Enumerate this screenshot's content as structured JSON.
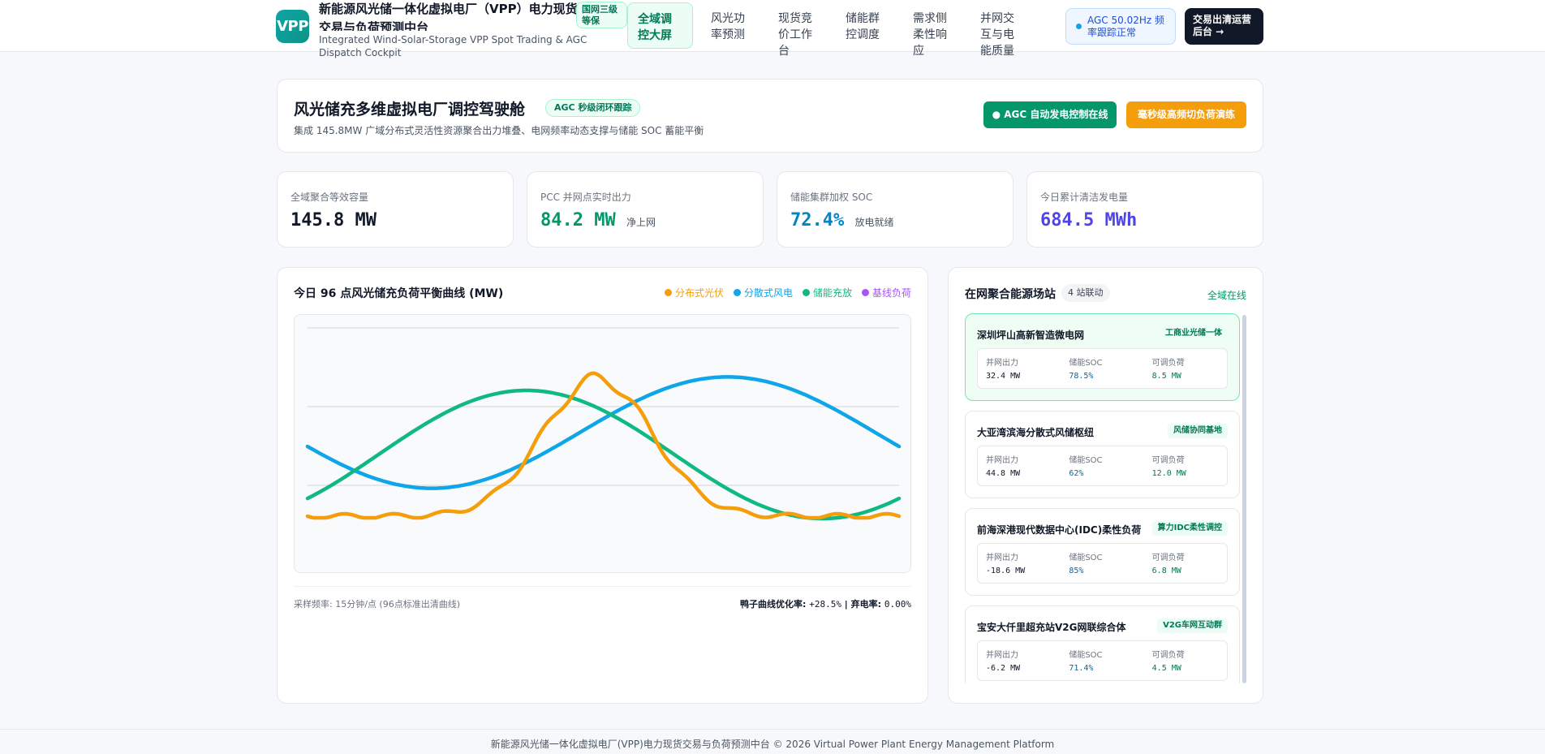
{
  "header": {
    "logo_text": "VPP",
    "title": "新能源风光储一体化虚拟电厂（VPP）电力现货交易与负荷预测中台",
    "subtitle": "Integrated Wind-Solar-Storage VPP Spot Trading & AGC Dispatch Cockpit",
    "level_badge": "国网三级等保",
    "nav": [
      {
        "label": "全域调控大屏",
        "active": true
      },
      {
        "label": "风光功率预测",
        "active": false
      },
      {
        "label": "现货竞价工作台",
        "active": false
      },
      {
        "label": "储能群控调度",
        "active": false
      },
      {
        "label": "需求侧柔性响应",
        "active": false
      },
      {
        "label": "并网交互与电能质量",
        "active": false
      }
    ],
    "agc_status": "AGC 50.02Hz 频率跟踪正常",
    "admin_button": "交易出清运营后台 →"
  },
  "hero": {
    "title": "风光储充多维虚拟电厂调控驾驶舱",
    "badge": "AGC 秒级闭环跟踪",
    "description": "集成 145.8MW 广域分布式灵活性资源聚合出力堆叠、电网频率动态支撑与储能 SOC 蓄能平衡",
    "btn_agc": "● AGC 自动发电控制在线",
    "btn_drill": "毫秒级高频切负荷演练"
  },
  "kpis": [
    {
      "label": "全域聚合等效容量",
      "value": "145.8 MW",
      "unit": "",
      "color": "#111827"
    },
    {
      "label": "PCC 并网点实时出力",
      "value": "84.2 MW",
      "unit": "净上网",
      "color": "#059669"
    },
    {
      "label": "储能集群加权 SOC",
      "value": "72.4%",
      "unit": "放电就绪",
      "color": "#0284c7"
    },
    {
      "label": "今日累计清洁发电量",
      "value": "684.5 MWh",
      "unit": "",
      "color": "#4f46e5"
    }
  ],
  "chart": {
    "title": "今日 96 点风光储充负荷平衡曲线 (MW)",
    "footer_left": "采样频率: 15分钟/点 (96点标准出清曲线)",
    "footer_label_1": "鸭子曲线优化率: ",
    "footer_value_1": "+28.5%",
    "footer_sep": " | ",
    "footer_label_2": "弃电率: ",
    "footer_value_2": "0.00%"
  },
  "chart_data": {
    "type": "line",
    "points": 96,
    "grid": true,
    "series": [
      {
        "name": "分布式光伏",
        "color": "#f59e0b",
        "shape": "solar-peak-midday"
      },
      {
        "name": "分散式风电",
        "color": "#0ea5e9",
        "shape": "sine-high-start"
      },
      {
        "name": "储能充放",
        "color": "#10b981",
        "shape": "sine-peak-early"
      },
      {
        "name": "基线负荷",
        "color": "#a855f7",
        "shape": "hidden"
      }
    ]
  },
  "stations": {
    "title": "在网聚合能源场站",
    "count": "4 站联动",
    "online": "全域在线",
    "metric_labels": [
      "并网出力",
      "储能SOC",
      "可调负荷"
    ],
    "items": [
      {
        "name": "深圳坪山高新智造微电网",
        "tag": "工商业光储一体",
        "power": "32.4 MW",
        "soc": "78.5%",
        "flex": "8.5 MW",
        "active": true
      },
      {
        "name": "大亚湾滨海分散式风储枢纽",
        "tag": "风储协同基地",
        "power": "44.8 MW",
        "soc": "62%",
        "flex": "12.0 MW",
        "active": false
      },
      {
        "name": "前海深港现代数据中心(IDC)柔性负荷",
        "tag": "算力IDC柔性调控",
        "power": "-18.6 MW",
        "soc": "85%",
        "flex": "6.8 MW",
        "active": false
      },
      {
        "name": "宝安大仟里超充站V2G网联综合体",
        "tag": "V2G车网互动群",
        "power": "-6.2 MW",
        "soc": "71.4%",
        "flex": "4.5 MW",
        "active": false
      }
    ]
  },
  "footer": {
    "text": "新能源风光储一体化虚拟电厂(VPP)电力现货交易与负荷预测中台 © 2026 Virtual Power Plant Energy Management Platform"
  }
}
